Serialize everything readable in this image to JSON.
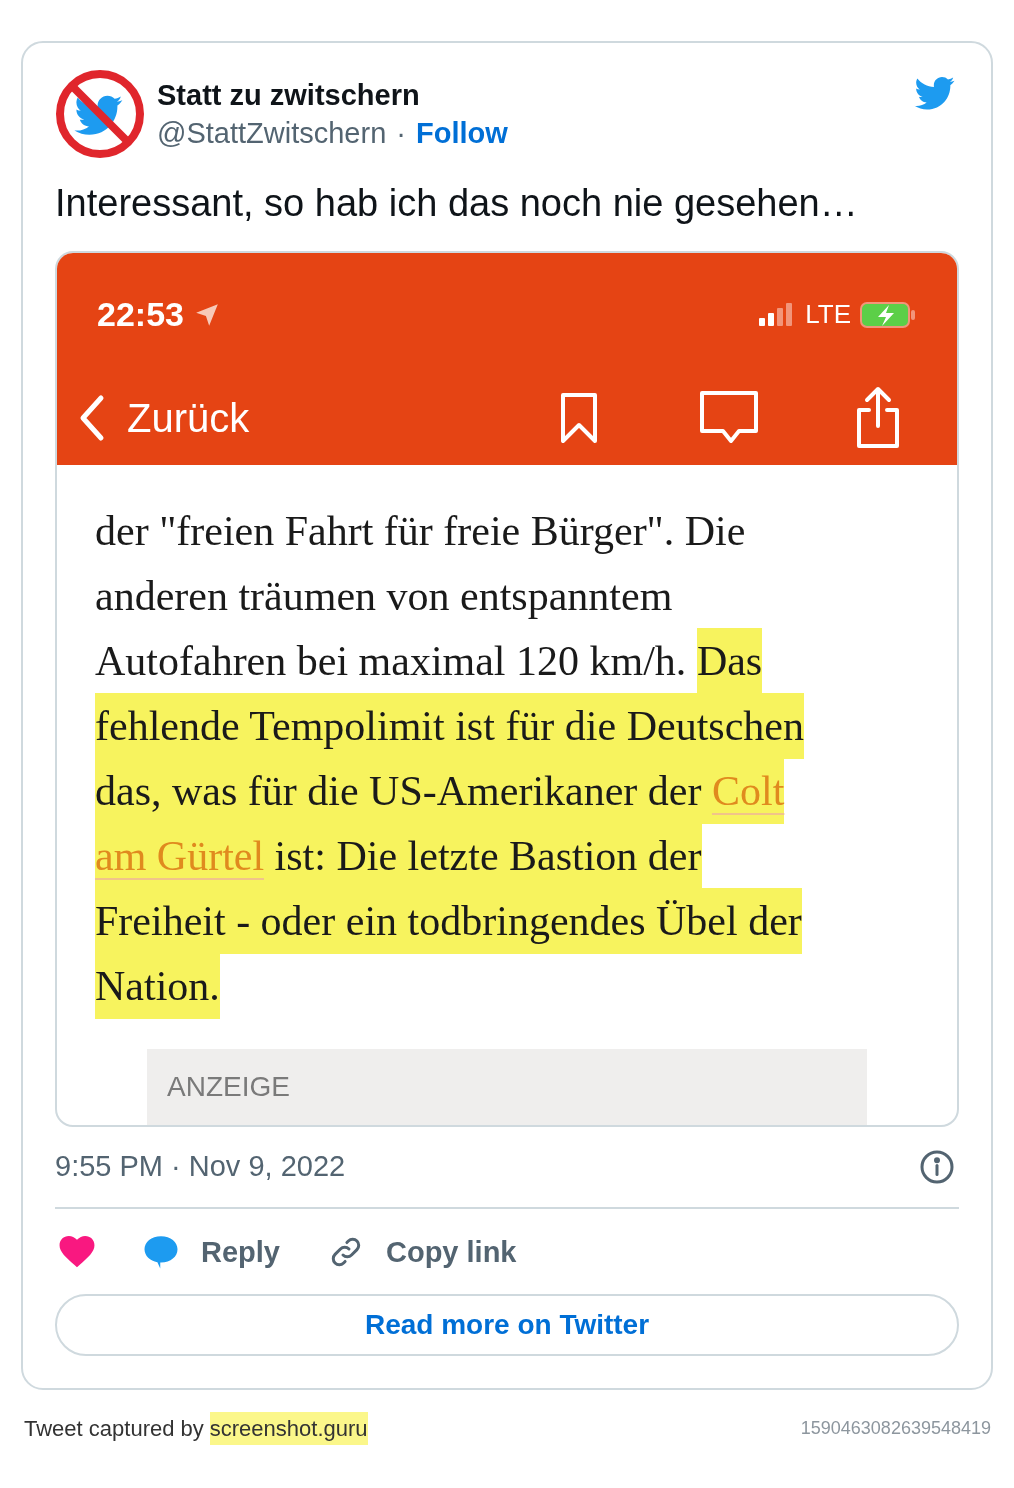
{
  "tweet": {
    "author_name": "Statt zu zwitschern",
    "handle": "@StattZwitschern",
    "separator": "·",
    "follow": "Follow",
    "text": "Interessant, so hab ich das noch nie gesehen…",
    "embedded_screenshot": {
      "status_bar": {
        "time": "22:53",
        "network": "LTE"
      },
      "nav": {
        "back": "Zurück"
      },
      "article": [
        {
          "segments": [
            {
              "kind": "text",
              "highlighted": false,
              "text": "der \"freien Fahrt für freie Bürger\". Die"
            }
          ]
        },
        {
          "segments": [
            {
              "kind": "text",
              "highlighted": false,
              "text": "anderen träumen von entspanntem"
            }
          ]
        },
        {
          "segments": [
            {
              "kind": "text",
              "highlighted": false,
              "text": "Autofahren bei maximal 120 km/h. "
            },
            {
              "kind": "text",
              "highlighted": true,
              "text": "Das"
            }
          ]
        },
        {
          "segments": [
            {
              "kind": "text",
              "highlighted": true,
              "text": "fehlende Tempolimit ist für die Deutschen"
            }
          ]
        },
        {
          "segments": [
            {
              "kind": "text",
              "highlighted": true,
              "text": "das, was für die US-Amerikaner der "
            },
            {
              "kind": "link",
              "highlighted": true,
              "text": "Colt"
            }
          ]
        },
        {
          "segments": [
            {
              "kind": "link",
              "highlighted": true,
              "text": "am Gürtel"
            },
            {
              "kind": "text",
              "highlighted": true,
              "text": " ist: Die letzte Bastion der"
            }
          ]
        },
        {
          "segments": [
            {
              "kind": "text",
              "highlighted": true,
              "text": "Freiheit - oder ein todbringendes Übel der"
            }
          ]
        },
        {
          "segments": [
            {
              "kind": "text",
              "highlighted": true,
              "text": "Nation."
            }
          ]
        }
      ],
      "ad_label": "ANZEIGE"
    },
    "timestamp": "9:55 PM · Nov 9, 2022",
    "actions": [
      {
        "kind": "like"
      },
      {
        "kind": "reply",
        "label": "Reply"
      },
      {
        "kind": "copy",
        "label": "Copy link"
      }
    ],
    "read_more": "Read more on Twitter"
  },
  "footer": {
    "captured_by": "Tweet captured by",
    "site": "screenshot.guru",
    "tweet_id": "1590463082639548419"
  }
}
